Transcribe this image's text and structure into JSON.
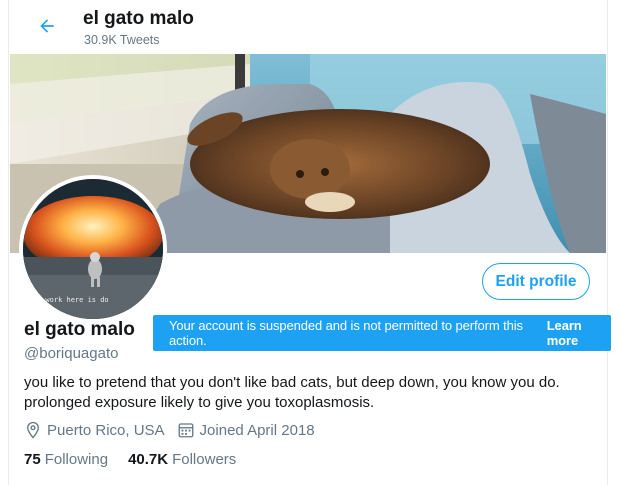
{
  "header": {
    "title": "el gato malo",
    "tweet_count": "30.9K Tweets"
  },
  "avatar": {
    "caption": "y work here is do"
  },
  "profile": {
    "edit_label": "Edit profile",
    "name": "el gato malo",
    "handle": "@boriquagato",
    "bio_line1": "you like to pretend that you don't like bad cats, but deep down, you know you do.",
    "bio_line2": "prolonged exposure likely to give you toxoplasmosis.",
    "location": "Puerto Rico, USA",
    "joined": "Joined April 2018",
    "following_count": "75",
    "following_label": "Following",
    "followers_count": "40.7K",
    "followers_label": "Followers"
  },
  "toast": {
    "message": "Your account is suspended and is not permitted to perform this action.",
    "link": "Learn more"
  },
  "colors": {
    "accent": "#1da1f2",
    "secondary_text": "#657786",
    "primary_text": "#14171a"
  },
  "icons": [
    "back-arrow-icon",
    "location-pin-icon",
    "calendar-icon"
  ]
}
